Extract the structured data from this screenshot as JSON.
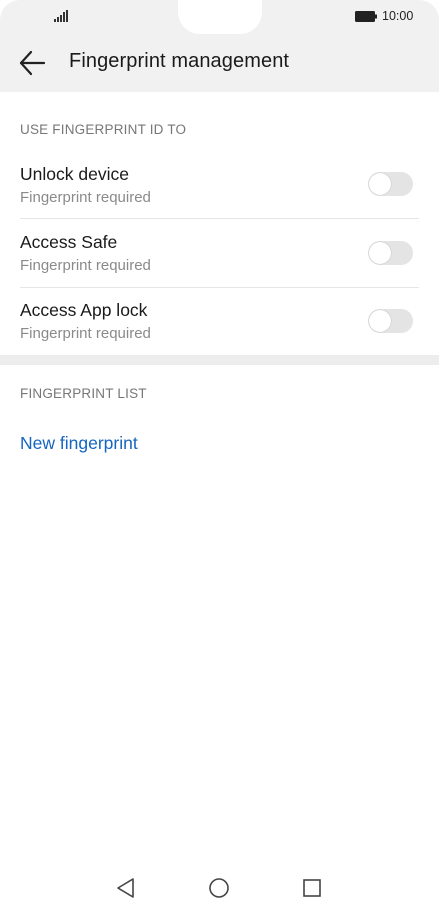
{
  "status_bar": {
    "time": "10:00",
    "signal_icon": "signal-icon",
    "battery_icon": "battery-icon"
  },
  "header": {
    "title": "Fingerprint management",
    "back_icon": "arrow-left-icon"
  },
  "use_section": {
    "label": "USE FINGERPRINT ID TO",
    "items": [
      {
        "title": "Unlock device",
        "subtitle": "Fingerprint required",
        "enabled": false
      },
      {
        "title": "Access Safe",
        "subtitle": "Fingerprint required",
        "enabled": false
      },
      {
        "title": "Access App lock",
        "subtitle": "Fingerprint required",
        "enabled": false
      }
    ]
  },
  "list_section": {
    "label": "FINGERPRINT LIST",
    "new_fingerprint_label": "New fingerprint"
  },
  "nav_bar": {
    "back_icon": "triangle-back-icon",
    "home_icon": "circle-home-icon",
    "recents_icon": "square-recents-icon"
  },
  "colors": {
    "accent": "#1565c0",
    "header_bg": "#f1f1f1",
    "toggle_off": "#e4e4e4"
  }
}
